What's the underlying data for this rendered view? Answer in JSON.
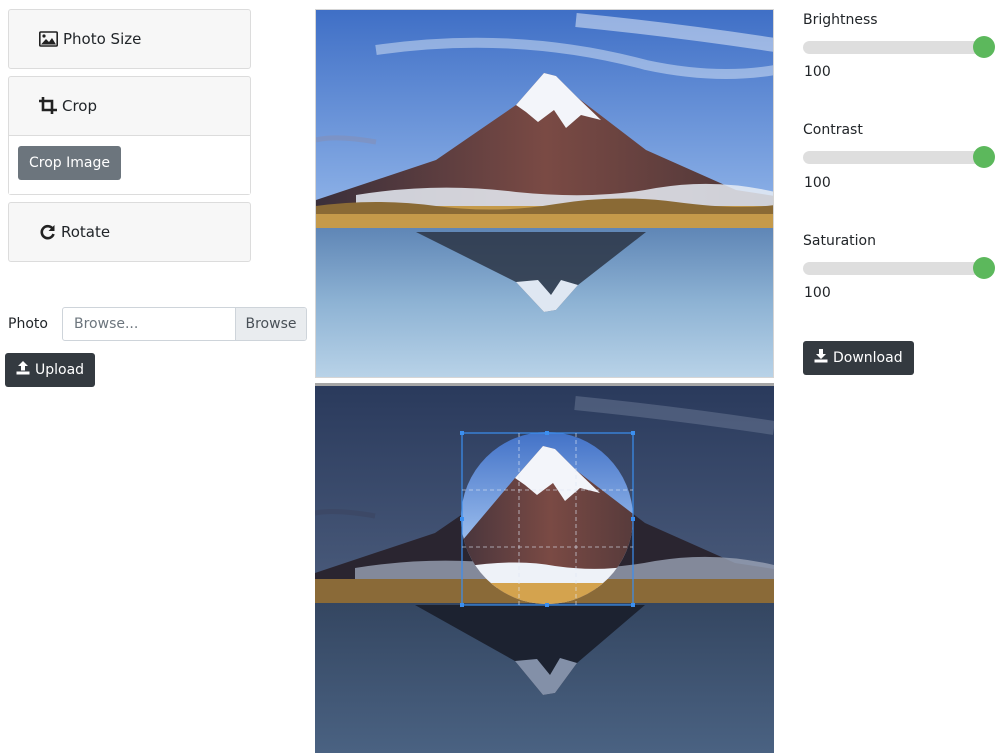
{
  "accordion": {
    "photo_size_label": "Photo Size",
    "crop_label": "Crop",
    "crop_button": "Crop Image",
    "rotate_label": "Rotate"
  },
  "upload": {
    "photo_label": "Photo",
    "file_placeholder": "Browse...",
    "browse_label": "Browse",
    "upload_button": "Upload"
  },
  "adjustments": [
    {
      "label": "Brightness",
      "value": "100",
      "fraction": 1.0
    },
    {
      "label": "Contrast",
      "value": "100",
      "fraction": 1.0
    },
    {
      "label": "Saturation",
      "value": "100",
      "fraction": 1.0
    }
  ],
  "download_button": "Download",
  "colors": {
    "slider_thumb": "#5cb85c",
    "dark_button": "#343a40",
    "secondary_button": "#6c757d",
    "crop_frame": "#3b8ff0"
  },
  "icons": {
    "photo_size": "image-icon",
    "crop": "crop-icon",
    "rotate": "rotate-icon",
    "upload": "upload-icon",
    "download": "download-icon"
  }
}
